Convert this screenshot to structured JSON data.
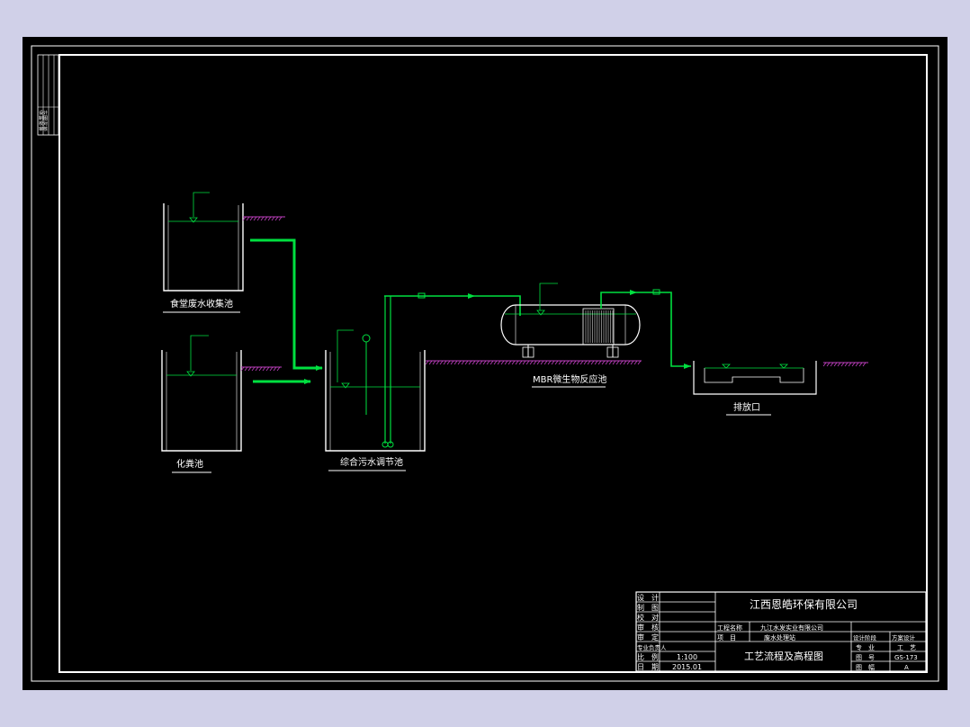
{
  "labels": {
    "canteen_tank": "食堂废水收集池",
    "septic_tank": "化粪池",
    "equalization_tank": "综合污水调节池",
    "mbr_tank": "MBR微生物反应池",
    "outlet": "排放口"
  },
  "margin_table": [
    "设计",
    "制图",
    "校对",
    "审核"
  ],
  "title_block": {
    "company": "江西恩皓环保有限公司",
    "rows_left": [
      "设　计",
      "制　图",
      "校　对",
      "审　核",
      "审　定",
      "专业负责人",
      "比　例",
      "日　期"
    ],
    "scale": "1:100",
    "date": "2015.01",
    "project_label": "工程名称",
    "project_value": "九江水发实业有限公司",
    "item_label": "项　目",
    "item_value": "废水处理站",
    "drawing_title": "工艺流程及高程图",
    "stage_label": "设计阶段",
    "stage_value": "方案设计",
    "discipline_label": "专　业",
    "discipline_value": "工　艺",
    "number_label": "图　号",
    "number_value": "GS-173",
    "version_label": "图　幅",
    "version_value": "A"
  },
  "colors": {
    "background": "#000000",
    "outline": "#ffffff",
    "pipe": "#00e040",
    "ground": "#c040c0",
    "water_level": "#00e040",
    "canvas_frame": "#d0d0e8"
  }
}
